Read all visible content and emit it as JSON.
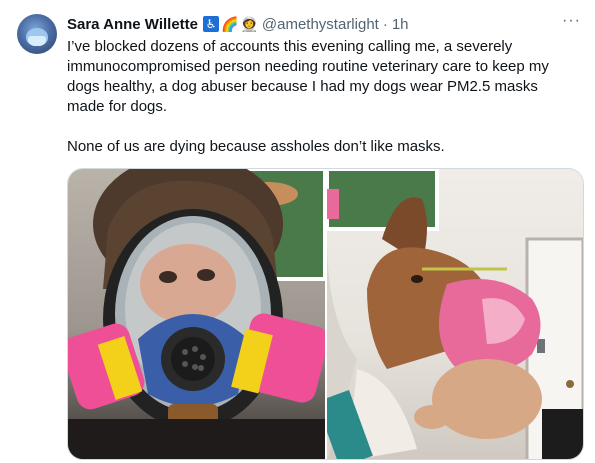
{
  "tweet": {
    "author_name": "Sara Anne Willette",
    "author_badges": [
      "wheelchair-icon",
      "rainbow-icon",
      "astronaut-icon"
    ],
    "handle": "@amethystarlight",
    "separator": "·",
    "time": "1h",
    "more_label": "···",
    "paragraphs": [
      "I’ve blocked dozens of accounts this evening calling me, a severely immunocompromised person needing routine veterinary care to keep my dogs healthy, a dog abuser because I had my dogs wear PM2.5 masks made for dogs.",
      "None of us are dying because assholes don’t like masks."
    ],
    "media": [
      {
        "name": "photo-person-respirator",
        "subject": "person wearing full-face respirator"
      },
      {
        "name": "photo-dog-muzzle-mask",
        "subject": "dog wearing pink mask"
      }
    ]
  },
  "colors": {
    "text": "#0f1419",
    "secondary_text": "#536471",
    "border": "#cfd9de",
    "mask_pink": "#e86a9a",
    "cartridge_pink": "#ef4f96",
    "cartridge_yellow": "#f3d11a"
  }
}
